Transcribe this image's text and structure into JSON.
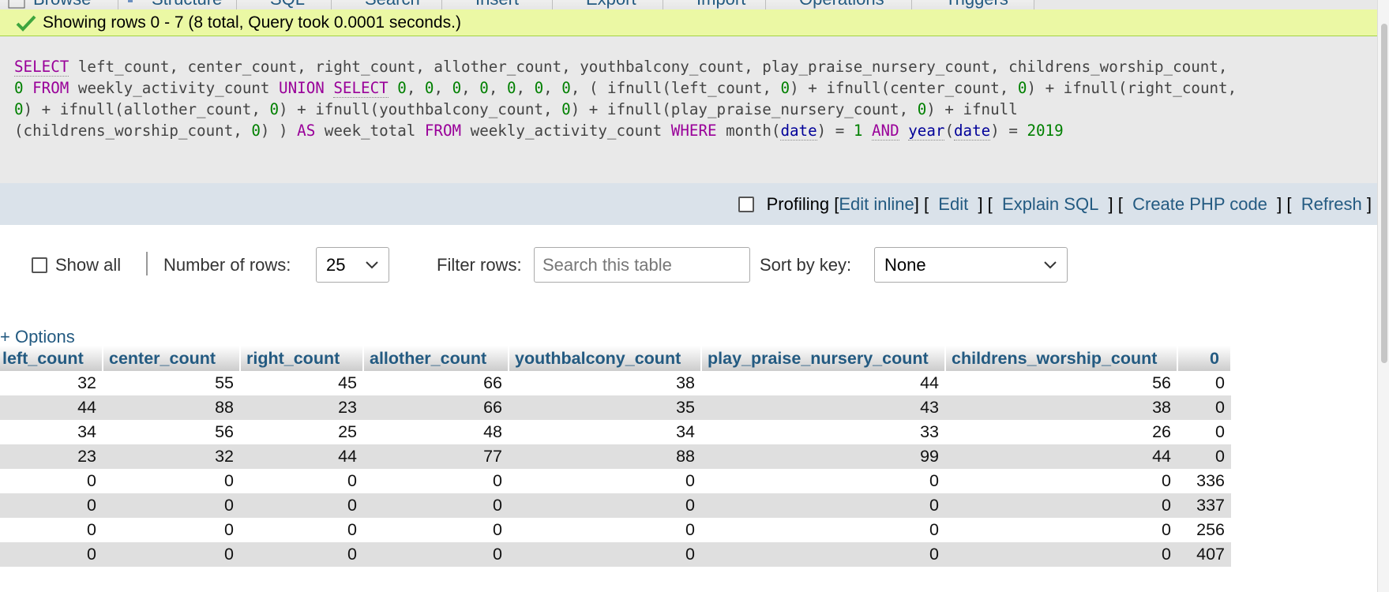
{
  "tabs": [
    "Browse",
    "Structure",
    "SQL",
    "Search",
    "Insert",
    "Export",
    "Import",
    "Operations",
    "Triggers"
  ],
  "success_message": "Showing rows 0 - 7 (8 total, Query took 0.0001 seconds.)",
  "sql_lines": [
    "SELECT left_count, center_count, right_count, allother_count, youthbalcony_count, play_praise_nursery_count, childrens_worship_count,",
    "0 FROM weekly_activity_count UNION SELECT 0, 0, 0, 0, 0, 0, 0, ( ifnull(left_count, 0) + ifnull(center_count, 0) + ifnull(right_count,",
    "0) + ifnull(allother_count, 0) + ifnull(youthbalcony_count, 0) + ifnull(play_praise_nursery_count, 0) + ifnull",
    "(childrens_worship_count, 0) ) AS week_total FROM weekly_activity_count WHERE month(date) = 1 AND year(date) = 2019"
  ],
  "tools": {
    "profiling": "Profiling",
    "edit_inline": "Edit inline",
    "edit": "Edit",
    "explain_sql": "Explain SQL",
    "create_php": "Create PHP code",
    "refresh": "Refresh"
  },
  "nav": {
    "show_all": "Show all",
    "number_of_rows_label": "Number of rows:",
    "number_of_rows_value": "25",
    "filter_label": "Filter rows:",
    "filter_placeholder": "Search this table",
    "sort_label": "Sort by key:",
    "sort_value": "None"
  },
  "options_link": "+ Options",
  "table": {
    "columns": [
      "left_count",
      "center_count",
      "right_count",
      "allother_count",
      "youthbalcony_count",
      "play_praise_nursery_count",
      "childrens_worship_count",
      "0"
    ],
    "rows": [
      [
        "32",
        "55",
        "45",
        "66",
        "38",
        "44",
        "56",
        "0"
      ],
      [
        "44",
        "88",
        "23",
        "66",
        "35",
        "43",
        "38",
        "0"
      ],
      [
        "34",
        "56",
        "25",
        "48",
        "34",
        "33",
        "26",
        "0"
      ],
      [
        "23",
        "32",
        "44",
        "77",
        "88",
        "99",
        "44",
        "0"
      ],
      [
        "0",
        "0",
        "0",
        "0",
        "0",
        "0",
        "0",
        "336"
      ],
      [
        "0",
        "0",
        "0",
        "0",
        "0",
        "0",
        "0",
        "337"
      ],
      [
        "0",
        "0",
        "0",
        "0",
        "0",
        "0",
        "0",
        "256"
      ],
      [
        "0",
        "0",
        "0",
        "0",
        "0",
        "0",
        "0",
        "407"
      ]
    ]
  },
  "colors": {
    "link": "#235a81",
    "success_bg": "#ebf8a4",
    "sql_bg": "#e9e9e9",
    "tools_bg": "#dae2ea",
    "row_alt": "#dfdfdf"
  }
}
